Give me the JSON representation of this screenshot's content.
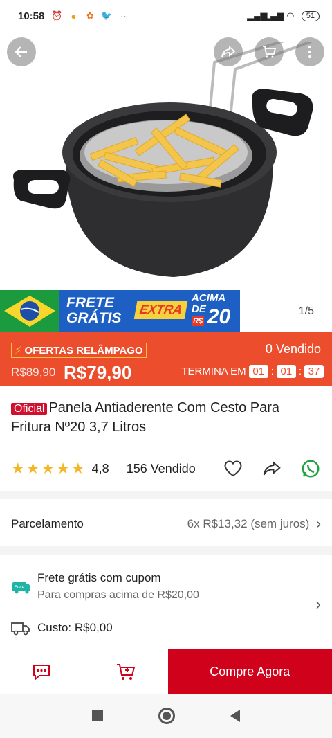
{
  "status_bar": {
    "time": "10:58",
    "battery": "51",
    "icons_left": [
      "alarm-icon",
      "app-icon",
      "notification-icon",
      "twitter-icon",
      "more-dots-icon"
    ],
    "icons_right": [
      "signal-icon",
      "signal-icon",
      "wifi-icon",
      "battery-icon"
    ]
  },
  "hero": {
    "page_counter": "1/5",
    "top_buttons": [
      "back-icon",
      "share-icon",
      "cart-icon",
      "more-vertical-icon"
    ],
    "banner": {
      "line1": "FRETE",
      "line2": "GRÁTIS",
      "extra": "EXTRA",
      "acima1": "ACIMA",
      "acima2": "DE",
      "currency": "R$",
      "value": "20"
    }
  },
  "flash_offer": {
    "label": "OFERTAS RELÂMPAGO",
    "sold": "0 Vendido",
    "old_price": "R$89,90",
    "new_price": "R$79,90",
    "ends_label": "TERMINA EM",
    "hours": "01",
    "minutes": "01",
    "seconds": "37",
    "colors": {
      "bar": "#ec4e2d",
      "accent": "#f6c33b"
    }
  },
  "product": {
    "badge": "Oficial",
    "title": "Panela Antiaderente Com Cesto Para Fritura Nº20 3,7 Litros",
    "rating": "4,8",
    "rating_value": 4.8,
    "sold": "156 Vendido"
  },
  "installments": {
    "label": "Parcelamento",
    "value": "6x R$13,32 (sem juros)"
  },
  "shipping": {
    "tag": "Frete",
    "title": "Frete grátis com cupom",
    "subtitle": "Para compras acima de R$20,00",
    "cost": "Custo: R$0,00"
  },
  "action_bar": {
    "buy_now": "Compre Agora",
    "brand_color": "#d0011b"
  }
}
